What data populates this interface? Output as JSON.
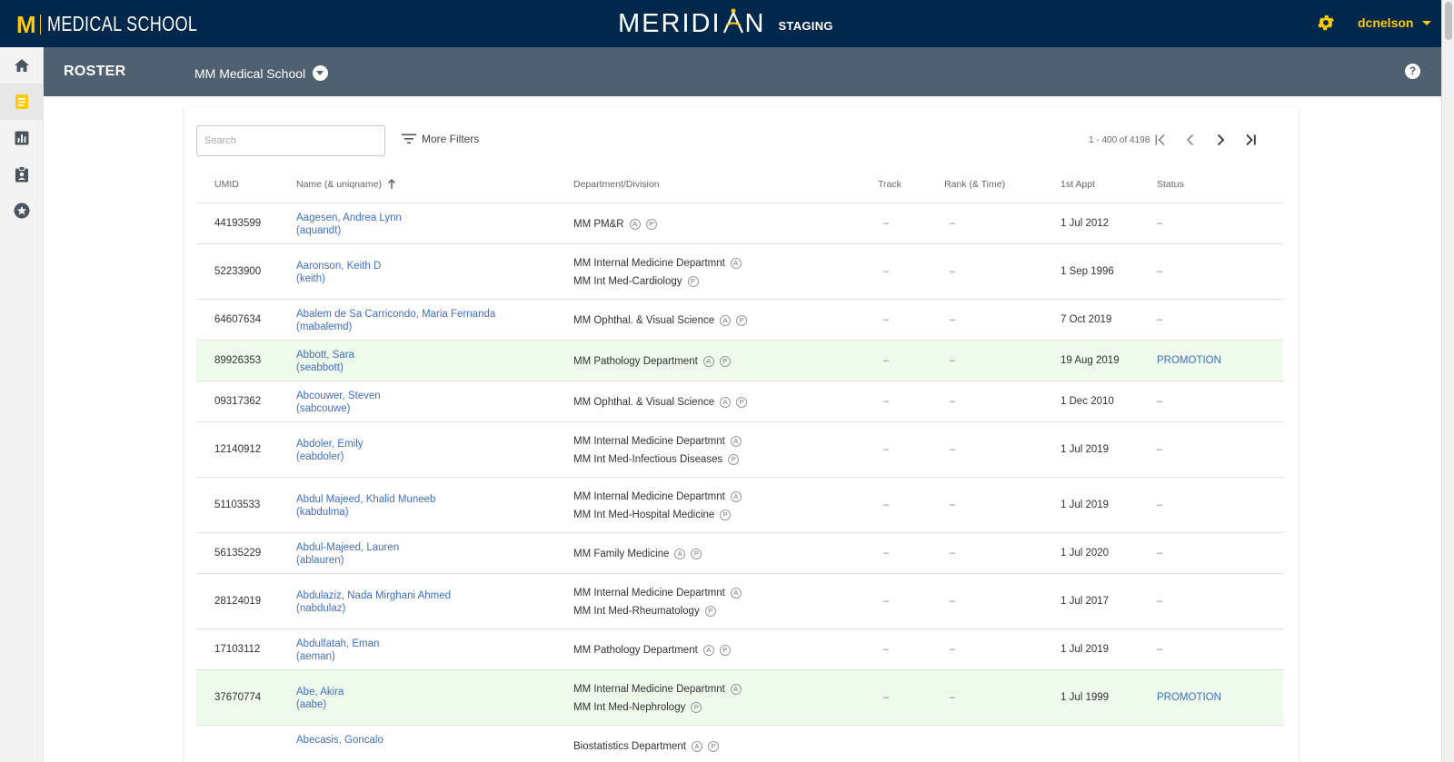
{
  "header": {
    "brand_mark": "M",
    "brand_text": "MEDICAL SCHOOL",
    "app_name_left": "MERIDI",
    "app_name_right": "N",
    "environment": "STAGING",
    "username": "dcnelson"
  },
  "subheader": {
    "title": "ROSTER",
    "school": "MM Medical School",
    "help": "?"
  },
  "colors": {
    "navy": "#00274c",
    "maize": "#ffcb05",
    "subbar": "#4f6070",
    "link": "#3f6ec7",
    "promo_bg": "#eefaea"
  },
  "sidenav": {
    "items": [
      "home-icon",
      "roster-icon",
      "reports-icon",
      "clipboard-icon",
      "star-icon"
    ],
    "active": 1
  },
  "toolbar": {
    "search_placeholder": "Search",
    "more_filters": "More Filters",
    "page_info": "1 - 400 of 4198"
  },
  "table": {
    "columns": {
      "umid": "UMID",
      "name": "Name (& uniqname)",
      "dept": "Department/Division",
      "track": "Track",
      "rank": "Rank (& Time)",
      "appt": "1st Appt",
      "status": "Status"
    },
    "rows": [
      {
        "umid": "44193599",
        "name": "Aagesen, Andrea Lynn",
        "uniq": "(aquandt)",
        "depts": [
          {
            "text": "MM PM&R",
            "badges": [
              "A",
              "P"
            ]
          }
        ],
        "track": "–",
        "rank": "–",
        "appt": "1 Jul 2012",
        "status": "–"
      },
      {
        "umid": "52233900",
        "name": "Aaronson, Keith D",
        "uniq": "(keith)",
        "depts": [
          {
            "text": "MM Internal Medicine Departmnt",
            "badges": [
              "A"
            ]
          },
          {
            "text": "MM Int Med-Cardiology",
            "badges": [
              "P"
            ]
          }
        ],
        "track": "–",
        "rank": "–",
        "appt": "1 Sep 1996",
        "status": "–"
      },
      {
        "umid": "64607634",
        "name": "Abalem de Sa Carricondo, Maria Fernanda",
        "uniq": "(mabalemd)",
        "depts": [
          {
            "text": "MM Ophthal. & Visual Science",
            "badges": [
              "A",
              "P"
            ]
          }
        ],
        "track": "–",
        "rank": "–",
        "appt": "7 Oct 2019",
        "status": "–"
      },
      {
        "umid": "89926353",
        "name": "Abbott, Sara",
        "uniq": "(seabbott)",
        "depts": [
          {
            "text": "MM Pathology Department",
            "badges": [
              "A",
              "P"
            ]
          }
        ],
        "track": "–",
        "rank": "–",
        "appt": "19 Aug 2019",
        "status": "PROMOTION"
      },
      {
        "umid": "09317362",
        "name": "Abcouwer, Steven",
        "uniq": "(sabcouwe)",
        "depts": [
          {
            "text": "MM Ophthal. & Visual Science",
            "badges": [
              "A",
              "P"
            ]
          }
        ],
        "track": "–",
        "rank": "–",
        "appt": "1 Dec 2010",
        "status": "–"
      },
      {
        "umid": "12140912",
        "name": "Abdoler, Emily",
        "uniq": "(eabdoler)",
        "depts": [
          {
            "text": "MM Internal Medicine Departmnt",
            "badges": [
              "A"
            ]
          },
          {
            "text": "MM Int Med-Infectious Diseases",
            "badges": [
              "P"
            ]
          }
        ],
        "track": "–",
        "rank": "–",
        "appt": "1 Jul 2019",
        "status": "–"
      },
      {
        "umid": "51103533",
        "name": "Abdul Majeed, Khalid Muneeb",
        "uniq": "(kabdulma)",
        "depts": [
          {
            "text": "MM Internal Medicine Departmnt",
            "badges": [
              "A"
            ]
          },
          {
            "text": "MM Int Med-Hospital Medicine",
            "badges": [
              "P"
            ]
          }
        ],
        "track": "–",
        "rank": "–",
        "appt": "1 Jul 2019",
        "status": "–"
      },
      {
        "umid": "56135229",
        "name": "Abdul-Majeed, Lauren",
        "uniq": "(ablauren)",
        "depts": [
          {
            "text": "MM Family Medicine",
            "badges": [
              "A",
              "P"
            ]
          }
        ],
        "track": "–",
        "rank": "–",
        "appt": "1 Jul 2020",
        "status": "–"
      },
      {
        "umid": "28124019",
        "name": "Abdulaziz, Nada Mirghani Ahmed",
        "uniq": "(nabdulaz)",
        "depts": [
          {
            "text": "MM Internal Medicine Departmnt",
            "badges": [
              "A"
            ]
          },
          {
            "text": "MM Int Med-Rheumatology",
            "badges": [
              "P"
            ]
          }
        ],
        "track": "–",
        "rank": "–",
        "appt": "1 Jul 2017",
        "status": "–"
      },
      {
        "umid": "17103112",
        "name": "Abdulfatah, Eman",
        "uniq": "(aeman)",
        "depts": [
          {
            "text": "MM Pathology Department",
            "badges": [
              "A",
              "P"
            ]
          }
        ],
        "track": "–",
        "rank": "–",
        "appt": "1 Jul 2019",
        "status": "–"
      },
      {
        "umid": "37670774",
        "name": "Abe, Akira",
        "uniq": "(aabe)",
        "depts": [
          {
            "text": "MM Internal Medicine Departmnt",
            "badges": [
              "A"
            ]
          },
          {
            "text": "MM Int Med-Nephrology",
            "badges": [
              "P"
            ]
          }
        ],
        "track": "–",
        "rank": "–",
        "appt": "1 Jul 1999",
        "status": "PROMOTION"
      },
      {
        "umid": "",
        "name": "Abecasis, Goncalo",
        "uniq": "",
        "depts": [
          {
            "text": "Biostatistics Department",
            "badges": [
              "A",
              "P"
            ]
          }
        ],
        "track": "",
        "rank": "",
        "appt": "",
        "status": ""
      }
    ]
  }
}
